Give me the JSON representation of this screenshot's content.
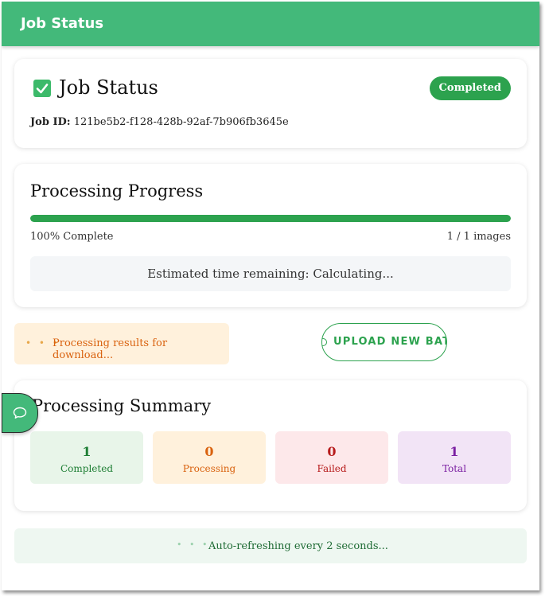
{
  "appbar": {
    "title": "Job Status"
  },
  "status_card": {
    "title": "Job Status",
    "badge": "Completed",
    "job_id_label": "Job ID:",
    "job_id": "121be5b2-f128-428b-92af-7b906fb3645e"
  },
  "progress": {
    "title": "Processing Progress",
    "fraction": 1.0,
    "percent_text": "100% Complete",
    "count_text": "1 / 1 images",
    "eta_text": "Estimated time remaining: Calculating..."
  },
  "processing_message": {
    "dots": "• • •",
    "text": "Processing results for download..."
  },
  "upload_button": {
    "label": "UPLOAD NEW BATCH"
  },
  "summary": {
    "title": "Processing Summary",
    "stats": [
      {
        "value": "1",
        "label": "Completed"
      },
      {
        "value": "0",
        "label": "Processing"
      },
      {
        "value": "0",
        "label": "Failed"
      },
      {
        "value": "1",
        "label": "Total"
      }
    ]
  },
  "auto_refresh": {
    "dots": "• • •",
    "text": "Auto-refreshing every 2 seconds..."
  },
  "icons": {
    "status": "check-box-icon",
    "chat": "chat-bubble-icon"
  },
  "colors": {
    "brand": "#43b97a",
    "success": "#2ca24e",
    "warning": "#d9620f",
    "error": "#b71c1c",
    "total": "#7b1fa2"
  }
}
